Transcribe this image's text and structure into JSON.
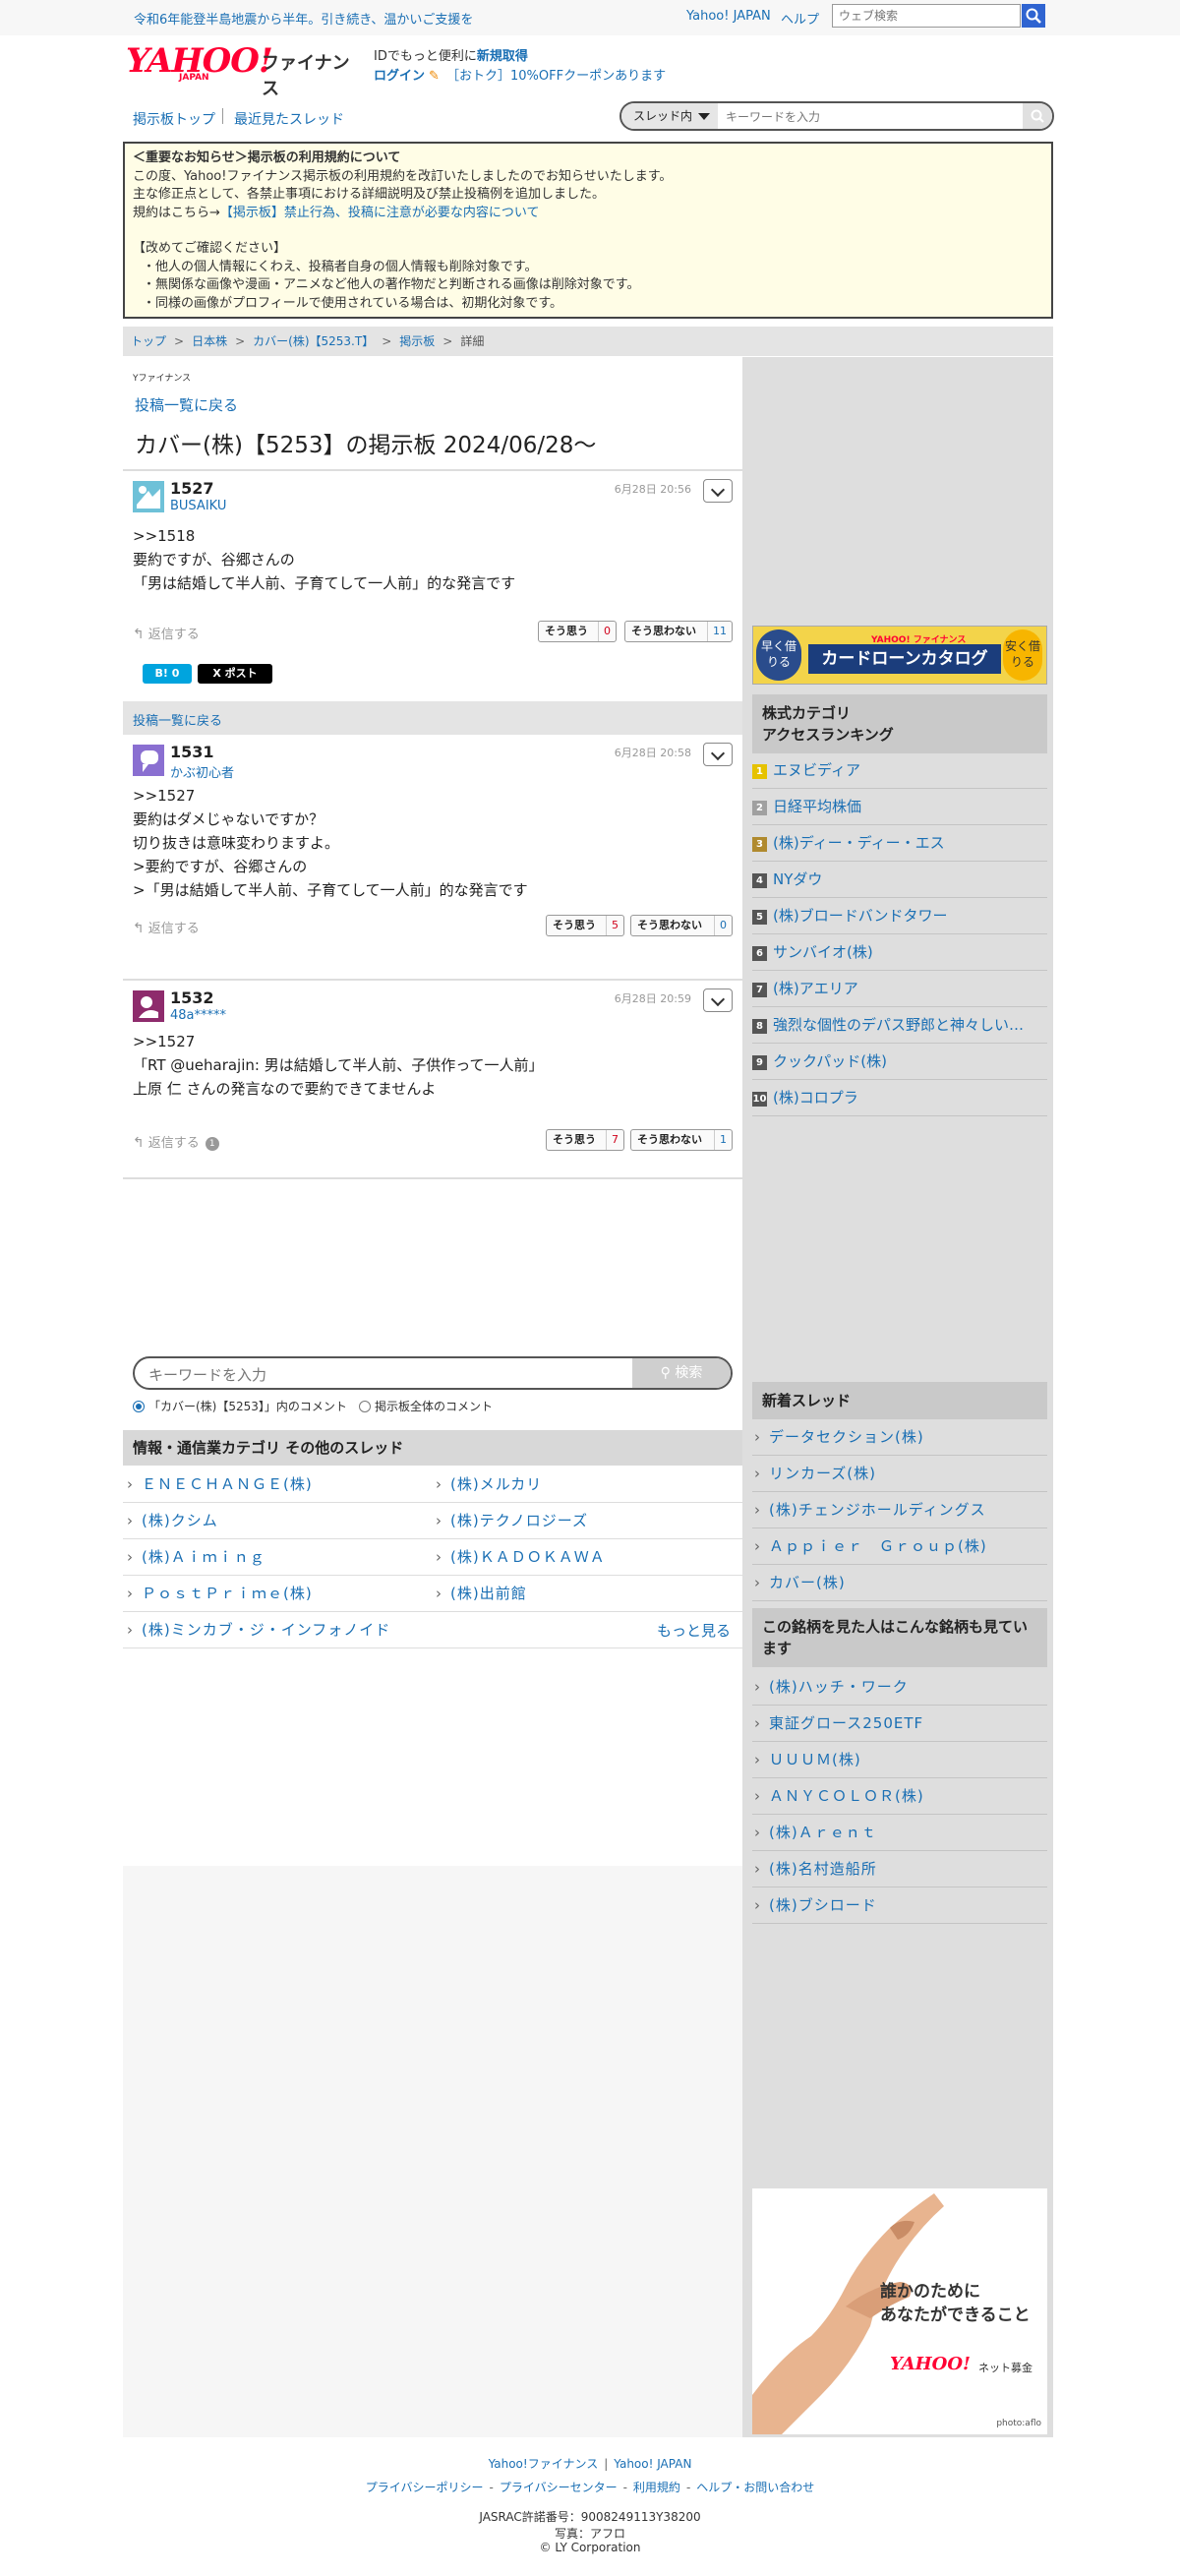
{
  "topbar": {
    "notice": "令和6年能登半島地震から半年。引き続き、温かいご支援を",
    "links": [
      "Yahoo! JAPAN",
      "ヘルプ"
    ],
    "search_placeholder": "ウェブ検索"
  },
  "header": {
    "logo_text": "YAHOO!",
    "logo_sub": "JAPAN",
    "logo_finance": "ファイナンス",
    "id_text": "IDでもっと便利に",
    "id_link": "新規取得",
    "login": "ログイン",
    "coupon": "［おトク］10%OFFクーポンあります"
  },
  "nav": {
    "board_top": "掲示板トップ",
    "recent": "最近見たスレッド",
    "scope": "スレッド内",
    "search_placeholder": "キーワードを入力"
  },
  "notice": {
    "title": "＜重要なお知らせ＞掲示板の利用規約について",
    "line1": "この度、Yahoo!ファイナンス掲示板の利用規約を改訂いたしましたのでお知らせいたします。",
    "line2": "主な修正点として、各禁止事項における詳細説明及び禁止投稿例を追加しました。",
    "line3_prefix": "規約はこちら→",
    "line3_link": "【掲示板】禁止行為、投稿に注意が必要な内容について",
    "confirm": "【改めてご確認ください】",
    "items": [
      "・他人の個人情報にくわえ、投稿者自身の個人情報も削除対象です。",
      "・無関係な画像や漫画・アニメなど他人の著作物だと判断される画像は削除対象です。",
      "・同様の画像がプロフィールで使用されている場合は、初期化対象です。"
    ]
  },
  "breadcrumb": [
    "トップ",
    "日本株",
    "カバー(株)【5253.T】",
    "掲示板",
    "詳細"
  ],
  "main": {
    "mini_logo": "Yファイナンス",
    "back": "投稿一覧に戻る",
    "title": "カバー(株)【5253】の掲示板 2024/06/28〜",
    "reply_label": "返信する",
    "agree_label": "そう思う",
    "disagree_label": "そう思わない",
    "share_b": "B! 0",
    "share_x": "X ポスト",
    "posts": [
      {
        "num": "1527",
        "user": "BUSAIKU",
        "date": "6月28日 20:56",
        "body": ">>1518\n要約ですが、谷郷さんの\n「男は結婚して半人前、子育てして一人前」的な発言です",
        "agree": "0",
        "disagree": "11",
        "reply_count": ""
      },
      {
        "num": "1531",
        "user": "かぶ初心者",
        "date": "6月28日 20:58",
        "body": ">>1527\n要約はダメじゃないですか？\n切り抜きは意味変わりますよ。\n>要約ですが、谷郷さんの\n>「男は結婚して半人前、子育てして一人前」的な発言です",
        "agree": "5",
        "disagree": "0",
        "reply_count": ""
      },
      {
        "num": "1532",
        "user": "48a*****",
        "date": "6月28日 20:59",
        "body": ">>1527\n「RT @ueharajin: 男は結婚して半人前、子供作って一人前」\n上原 仁 さんの発言なので要約できてませんよ",
        "agree": "7",
        "disagree": "1",
        "reply_count": "1"
      }
    ],
    "search": {
      "placeholder": "キーワードを入力",
      "button": "検索",
      "opt1": "「カバー(株)【5253】」内のコメント",
      "opt2": "掲示板全体のコメント"
    },
    "other_title": "情報・通信業カテゴリ その他のスレッド",
    "other_threads": [
      "ＥＮＥＣＨＡＮＧＥ(株)",
      "(株)メルカリ",
      "(株)クシム",
      "(株)テクノロジーズ",
      "(株)Ａｉｍｉｎｇ",
      "(株)ＫＡＤＯＫＡＷＡ",
      "ＰｏｓｔＰｒｉｍｅ(株)",
      "(株)出前館",
      "(株)ミンカブ・ジ・インフォノイド"
    ],
    "more": "もっと見る"
  },
  "sidebar": {
    "banner": {
      "left": "早く借りる",
      "main": "カードローンカタログ",
      "brand": "YAHOO! ファイナンス",
      "right": "安く借りる"
    },
    "ranking_title": "株式カテゴリ\nアクセスランキング",
    "ranking": [
      {
        "rank": "1",
        "name": "エヌビディア"
      },
      {
        "rank": "2",
        "name": "日経平均株価"
      },
      {
        "rank": "3",
        "name": "(株)ディー・ディー・エス"
      },
      {
        "rank": "4",
        "name": "NYダウ"
      },
      {
        "rank": "5",
        "name": "(株)ブロードバンドタワー"
      },
      {
        "rank": "6",
        "name": "サンバイオ(株)"
      },
      {
        "rank": "7",
        "name": "(株)アエリア"
      },
      {
        "rank": "8",
        "name": "強烈な個性のデパス野郎と神々しい…"
      },
      {
        "rank": "9",
        "name": "クックパッド(株)"
      },
      {
        "rank": "10",
        "name": "(株)コロプラ"
      }
    ],
    "new_title": "新着スレッド",
    "new_threads": [
      "データセクション(株)",
      "リンカーズ(株)",
      "(株)チェンジホールディングス",
      "Ａｐｐｉｅｒ　Ｇｒｏｕｐ(株)",
      "カバー(株)"
    ],
    "also_title": "この銘柄を見た人はこんな銘柄も見ています",
    "also_threads": [
      "(株)ハッチ・ワーク",
      "東証グロース250ETF",
      "ＵＵＵＭ(株)",
      "ＡＮＹＣＯＬＯＲ(株)",
      "(株)Ａｒｅｎｔ",
      "(株)名村造船所",
      "(株)ブシロード"
    ],
    "donate": {
      "line1": "誰かのために",
      "line2": "あなたができること",
      "logo": "YAHOO!",
      "sub": "ネット募金",
      "photo": "photo:aflo"
    }
  },
  "footer": {
    "links1": [
      "Yahoo!ファイナンス",
      "Yahoo! JAPAN"
    ],
    "links2": [
      "プライバシーポリシー",
      "プライバシーセンター",
      "利用規約",
      "ヘルプ・お問い合わせ"
    ],
    "jasrac": "JASRAC許諾番号：9008249113Y38200",
    "photo": "写真：アフロ",
    "copyright": "© LY Corporation"
  },
  "colors": {
    "link": "#1a6fb4",
    "brand": "#ff0033",
    "agree": "#d0021b",
    "notice_bg": "#fffde6"
  }
}
